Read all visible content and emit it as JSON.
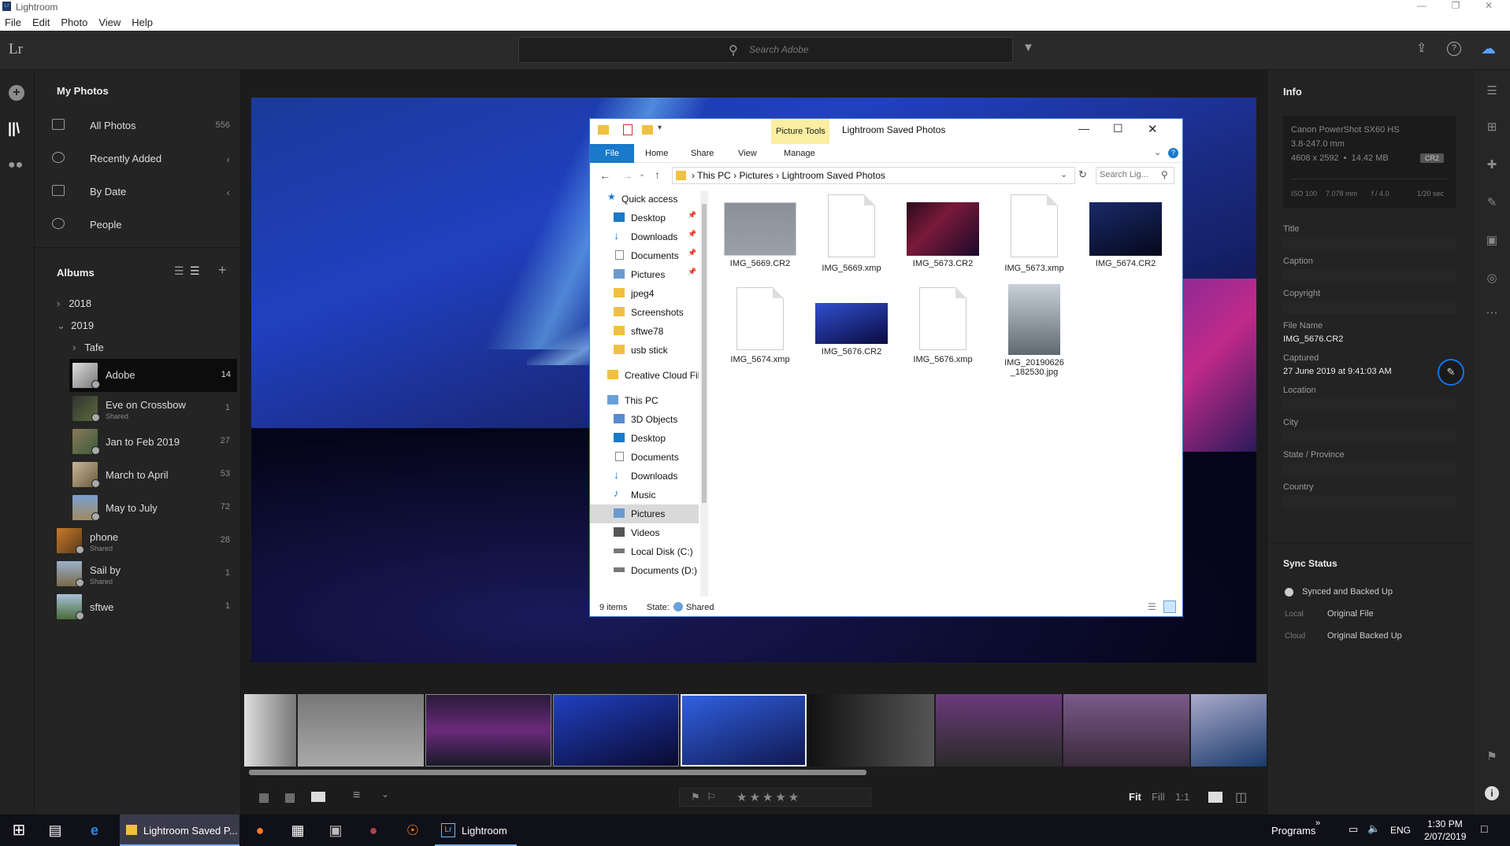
{
  "app": {
    "title": "Lightroom",
    "logo": "Lr"
  },
  "menu": [
    "File",
    "Edit",
    "Photo",
    "View",
    "Help"
  ],
  "search": {
    "placeholder": "Search Adobe"
  },
  "left": {
    "my_photos": "My Photos",
    "nav": [
      {
        "label": "All Photos",
        "count": "556"
      },
      {
        "label": "Recently Added",
        "count": ""
      },
      {
        "label": "By Date",
        "count": ""
      },
      {
        "label": "People",
        "count": ""
      }
    ],
    "albums_title": "Albums",
    "years": [
      "2018",
      "2019"
    ],
    "folder": "Tafe",
    "albums": [
      {
        "name": "Adobe",
        "count": "14",
        "shared": ""
      },
      {
        "name": "Eve on Crossbow",
        "count": "1",
        "shared": "Shared"
      },
      {
        "name": "Jan to Feb 2019",
        "count": "27",
        "shared": ""
      },
      {
        "name": "March to April",
        "count": "53",
        "shared": ""
      },
      {
        "name": "May to July",
        "count": "72",
        "shared": ""
      },
      {
        "name": "phone",
        "count": "28",
        "shared": "Shared"
      },
      {
        "name": "Sail by",
        "count": "1",
        "shared": "Shared"
      },
      {
        "name": "sftwe",
        "count": "1",
        "shared": ""
      }
    ]
  },
  "info": {
    "title": "Info",
    "camera": "Canon PowerShot SX60 HS",
    "lens": "3.8-247.0 mm",
    "dims": "4608 x 2592  •  14.42 MB",
    "format": "CR2",
    "iso": "ISO 100",
    "focal": "7.078 mm",
    "aperture": "f / 4.0",
    "shutter": "1/20 sec",
    "labels": {
      "title": "Title",
      "caption": "Caption",
      "copyright": "Copyright",
      "filename": "File Name",
      "captured": "Captured",
      "location": "Location",
      "city": "City",
      "state": "State / Province",
      "country": "Country"
    },
    "filename": "IMG_5676.CR2",
    "captured": "27 June 2019 at 9:41:03 AM",
    "sync_title": "Sync Status",
    "sync_state": "Synced and Backed Up",
    "local_label": "Local",
    "local_val": "Original File",
    "cloud_label": "Cloud",
    "cloud_val": "Original Backed Up"
  },
  "explorer": {
    "title": "Lightroom Saved Photos",
    "picture_tools": "Picture Tools",
    "tabs": [
      "File",
      "Home",
      "Share",
      "View",
      "Manage"
    ],
    "path": [
      "This PC",
      "Pictures",
      "Lightroom Saved Photos"
    ],
    "search_placeholder": "Search Lig...",
    "quick_access": "Quick access",
    "quick_items": [
      "Desktop",
      "Downloads",
      "Documents",
      "Pictures",
      "jpeg4",
      "Screenshots",
      "sftwe78",
      "usb stick"
    ],
    "creative_cloud": "Creative Cloud Fil",
    "this_pc": "This PC",
    "pc_items": [
      "3D Objects",
      "Desktop",
      "Documents",
      "Downloads",
      "Music",
      "Pictures",
      "Videos",
      "Local Disk (C:)",
      "Documents (D:)"
    ],
    "files": [
      "IMG_5669.CR2",
      "IMG_5669.xmp",
      "IMG_5673.CR2",
      "IMG_5673.xmp",
      "IMG_5674.CR2",
      "IMG_5674.xmp",
      "IMG_5676.CR2",
      "IMG_5676.xmp",
      "IMG_20190626_182530.jpg"
    ],
    "status_count": "9 items",
    "status_state": "State:",
    "status_shared": "Shared"
  },
  "bottom": {
    "fit": "Fit",
    "fill": "Fill",
    "ratio": "1:1"
  },
  "taskbar": {
    "explorer_label": "Lightroom Saved P...",
    "lightroom_label": "Lightroom",
    "programs": "Programs",
    "lang": "ENG",
    "time": "1:30 PM",
    "date": "2/07/2019"
  },
  "colors": {
    "accent": "#1473e6",
    "panel": "#242424",
    "selected": "#0a0a0a"
  }
}
